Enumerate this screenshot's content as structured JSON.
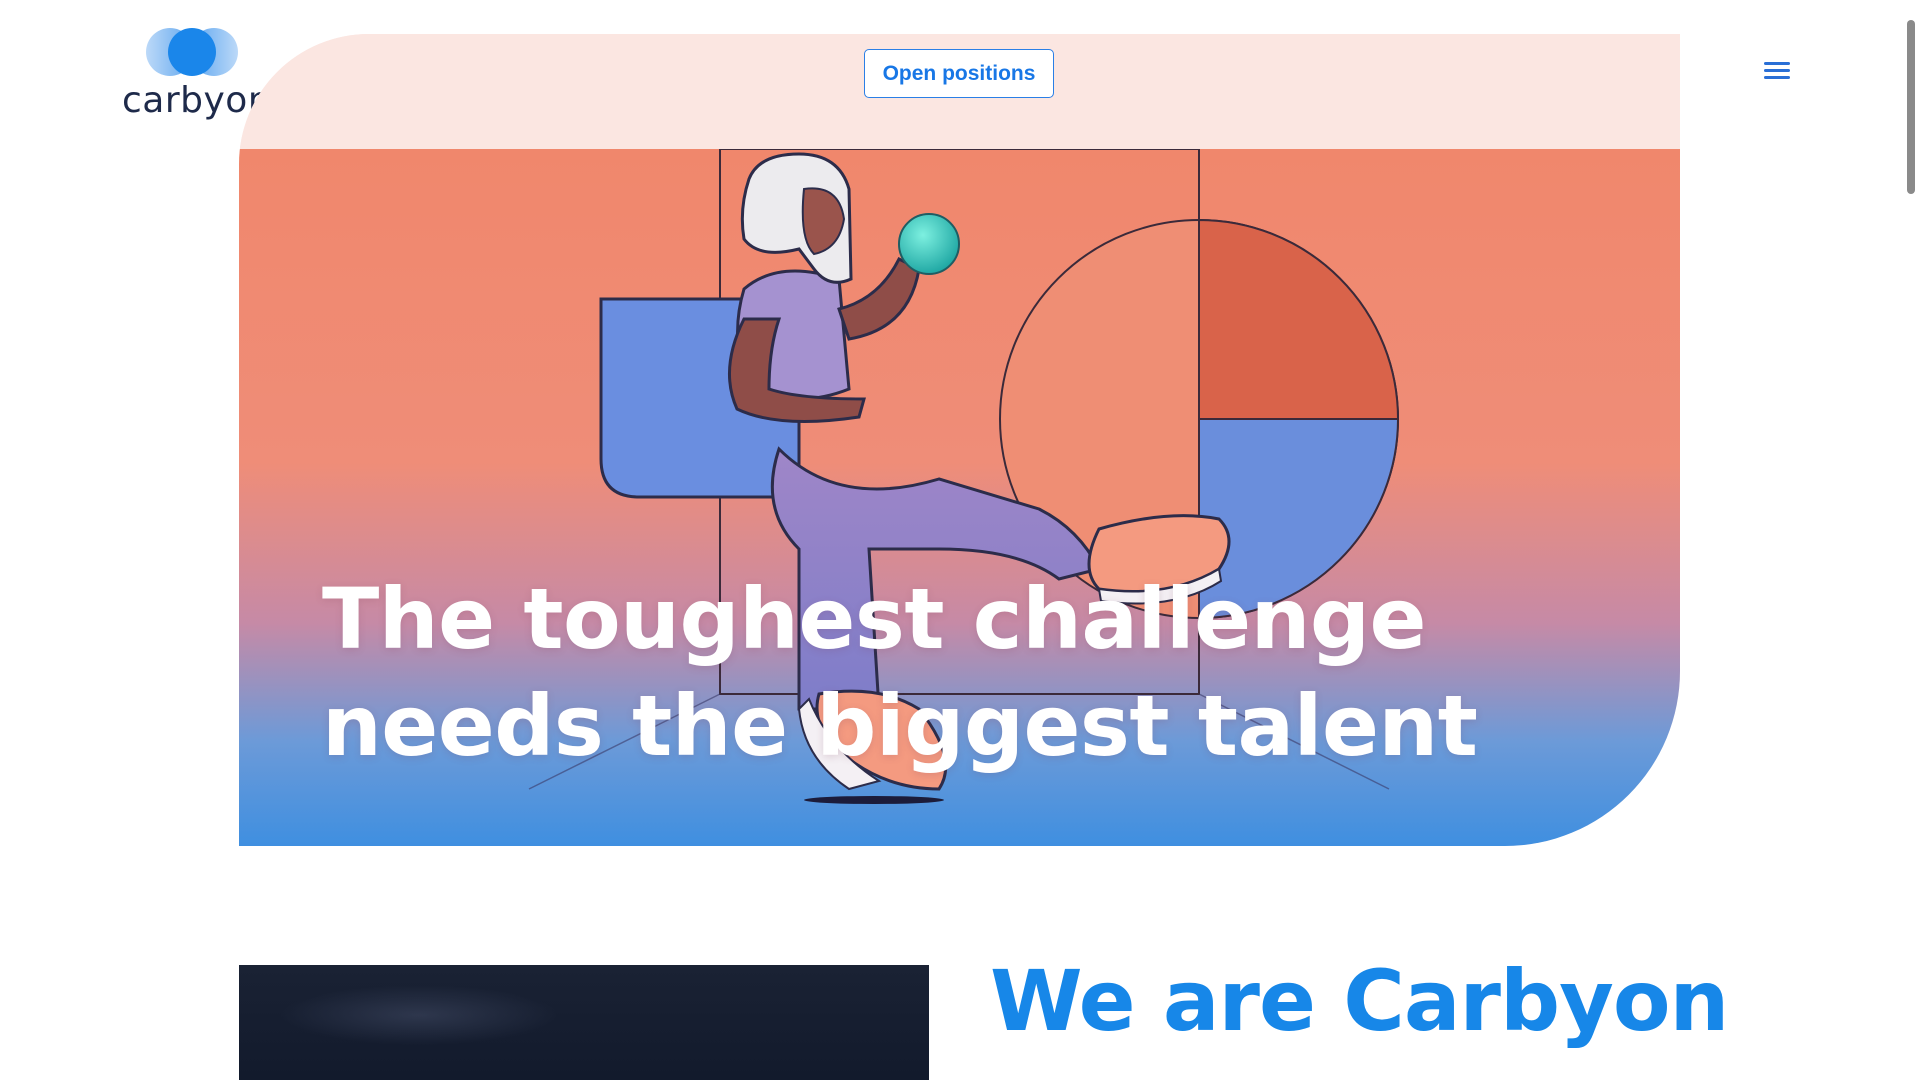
{
  "brand": {
    "name": "carbyon",
    "logo_icon": "overlapping-circles-logo-icon",
    "primary_color": "#1787e8",
    "dark_text_color": "#1e2a4a"
  },
  "header": {
    "cta_label": "Open positions",
    "menu_icon": "hamburger-menu-icon"
  },
  "hero": {
    "headline_line1": "The toughest challenge",
    "headline_line2": "needs the biggest talent",
    "illustration": "woman-sitting-holding-green-orb-illustration",
    "gradient_top": "#f0876c",
    "gradient_bottom": "#3f8fe0"
  },
  "about": {
    "title": "We are Carbyon"
  }
}
